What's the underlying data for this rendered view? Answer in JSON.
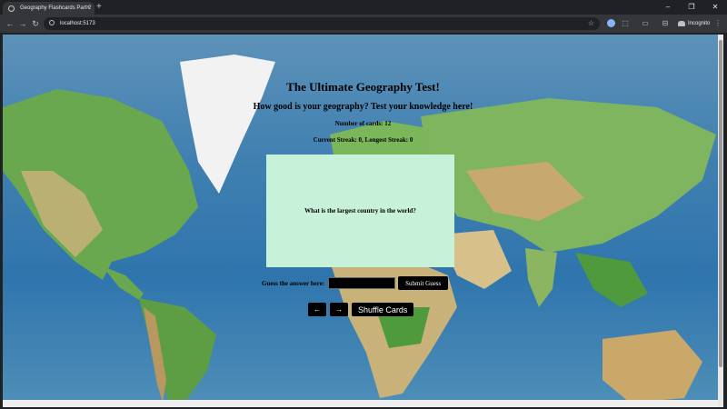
{
  "browser": {
    "tab_title": "Geography Flashcards Part 2",
    "tab_close": "×",
    "new_tab": "+",
    "url": "localhost:5173",
    "incognito_label": "Incognito",
    "window_controls": {
      "minimize": "–",
      "restore": "❐",
      "close": "✕"
    },
    "nav": {
      "back": "←",
      "forward": "→",
      "reload": "↻"
    }
  },
  "page": {
    "title": "The Ultimate Geography Test!",
    "subtitle": "How good is your geography? Test your knowledge here!",
    "card_count": "Number of cards: 12",
    "streaks": "Current Streak: 0, Longest Streak: 0"
  },
  "flashcard": {
    "question": "What is the largest country in the world?",
    "background": "#c7f1d9"
  },
  "guess": {
    "label": "Guess the answer here:",
    "value": "",
    "submit_label": "Submit Guess"
  },
  "controls": {
    "prev_label": "←",
    "next_label": "→",
    "shuffle_label": "Shuffle Cards"
  },
  "icons": {
    "favicon": "globe-icon",
    "omnibox": "info-icon",
    "bookmark": "star-icon",
    "extensions": "puzzle-icon",
    "incognito": "incognito-icon",
    "menu": "kebab-menu-icon"
  },
  "colors": {
    "ocean": "#2f75ad",
    "land_green": "#6aa84f",
    "land_tan": "#c9b27a",
    "ice": "#f2f2f2",
    "button_bg": "#000000"
  }
}
